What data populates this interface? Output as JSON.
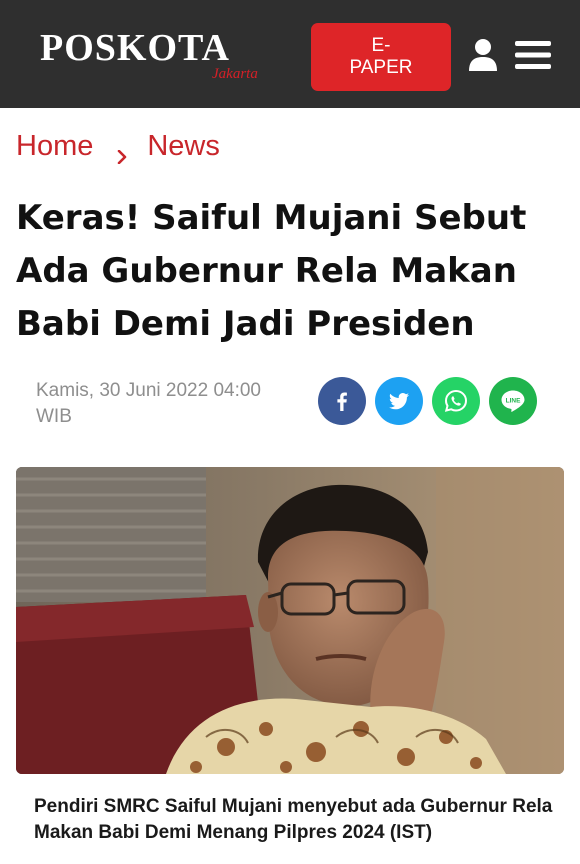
{
  "header": {
    "logo_text": "POSKOTA",
    "logo_subtext": "Jakarta",
    "epaper_label_line1": "E-",
    "epaper_label_line2": "PAPER",
    "icons": {
      "user": "user-icon",
      "menu": "hamburger-menu-icon"
    }
  },
  "breadcrumb": {
    "items": [
      {
        "label": "Home"
      },
      {
        "label": "News"
      }
    ],
    "separator_icon": "chevron-right-icon"
  },
  "article": {
    "title": "Keras! Saiful Mujani Sebut Ada Gubernur Rela Makan Babi Demi Jadi Presiden",
    "date": "Kamis, 30 Juni 2022 04:00 WIB",
    "share_buttons": [
      {
        "name": "facebook",
        "icon": "facebook-icon",
        "color": "#3b5998"
      },
      {
        "name": "twitter",
        "icon": "twitter-icon",
        "color": "#1da1f2"
      },
      {
        "name": "whatsapp",
        "icon": "whatsapp-icon",
        "color": "#25d366"
      },
      {
        "name": "line",
        "icon": "line-icon",
        "label": "LINE",
        "color": "#20b44d"
      }
    ],
    "caption": "Pendiri SMRC Saiful Mujani menyebut ada Gubernur Rela Makan Babi Demi Menang Pilpres 2024 (IST)"
  },
  "colors": {
    "header_bg": "#2f2f2f",
    "accent_red": "#de2528",
    "breadcrumb_red": "#c8262b",
    "meta_gray": "#8e8e8e"
  }
}
